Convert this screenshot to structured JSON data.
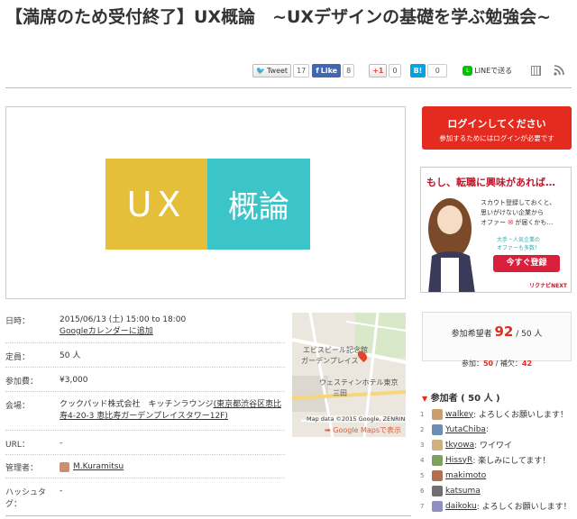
{
  "event": {
    "title": "【満席のため受付終了】UX概論　~UXデザインの基礎を学ぶ勉強会~"
  },
  "share": {
    "tweet_label": "Tweet",
    "tweet_count": "17",
    "like_label": "Like",
    "like_count": "8",
    "gplus_label": "+1",
    "gplus_count": "0",
    "hatena_label": "B!",
    "hatena_count": "0",
    "line_label": "LINEで送る"
  },
  "hero": {
    "logo_left": "UX",
    "logo_right": "概論"
  },
  "details": {
    "date_label": "日時：",
    "date_value": "2015/06/13 (土) 15:00 to 18:00",
    "calendar_link": "Googleカレンダーに追加",
    "capacity_label": "定員：",
    "capacity_value": "50 人",
    "fee_label": "参加費：",
    "fee_value": "¥3,000",
    "venue_label": "会場：",
    "venue_name": "クックパッド株式会社　キッチンラウンジ",
    "venue_address": "(東京都渋谷区恵比寿4-20-3 恵比寿ガーデンプレイスタワー12F)",
    "url_label": "URL：",
    "url_value": "-",
    "admin_label": "管理者：",
    "admin_value": "M.Kuramitsu",
    "hashtag_label": "ハッシュタグ：",
    "hashtag_value": "-"
  },
  "map": {
    "label1": "エビスビール記念館",
    "label2": "ガーデンプレイス",
    "label3": "ウェスティンホテル東京",
    "label4": "三田",
    "copyright": "Map data ©2015 Google, ZENRIN",
    "maps_link": "Google Mapsで表示"
  },
  "login": {
    "title": "ログインしてください",
    "sub": "参加するためにはログインが必要です"
  },
  "ad": {
    "headline": "もし、転職に興味があれば…",
    "line1": "スカウト登録しておくと、",
    "line2": "思いがけない企業から",
    "line3": "オファー",
    "line4": "が届くかも…",
    "note": "大手・人気企業の",
    "note2": "オファーも多数！",
    "button": "今すぐ登録",
    "brand": "リクナビNEXT"
  },
  "counts": {
    "hope_label": "参加希望者",
    "hope_value": "92",
    "hope_total": "/ 50 人",
    "join_label": "参加：",
    "join_value": "50",
    "wait_label": "/ 補欠：",
    "wait_value": "42"
  },
  "participants": {
    "header": "参加者 ( 50 人 )",
    "items": [
      {
        "num": "1",
        "name": "walkey",
        "comment": ": よろしくお願いします！",
        "color": "#c8a070"
      },
      {
        "num": "2",
        "name": "YutaChiba",
        "comment": ": ",
        "color": "#6a8fb0"
      },
      {
        "num": "3",
        "name": "tkyowa",
        "comment": ": ワイワイ",
        "color": "#d0b080"
      },
      {
        "num": "4",
        "name": "HissyR",
        "comment": ": 楽しみにしてます！",
        "color": "#80a060"
      },
      {
        "num": "5",
        "name": "makimoto",
        "comment": "",
        "color": "#b07050"
      },
      {
        "num": "6",
        "name": "katsuma",
        "comment": "",
        "color": "#707070"
      },
      {
        "num": "7",
        "name": "daikoku",
        "comment": ": よろしくお願いします！",
        "color": "#9090c0"
      }
    ]
  }
}
